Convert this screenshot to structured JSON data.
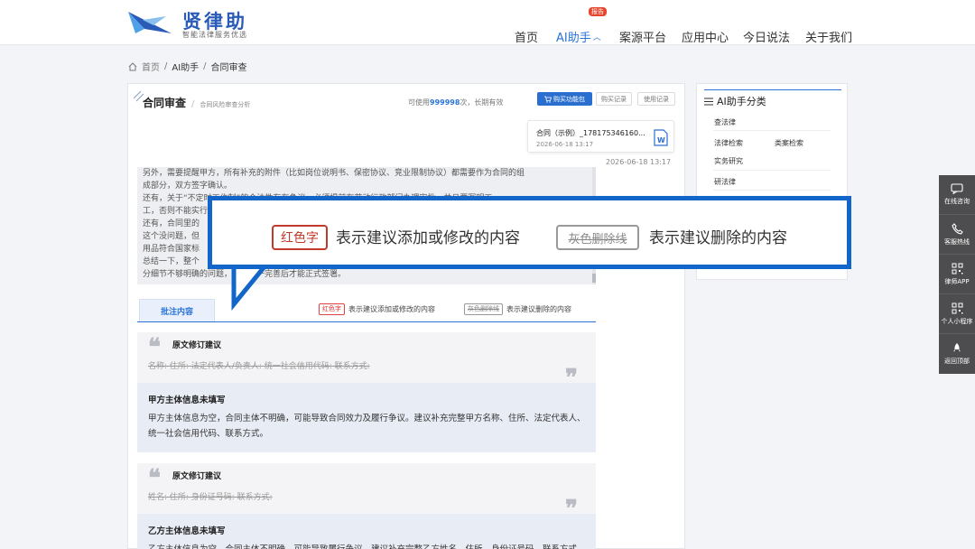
{
  "brand": {
    "name": "贤律助",
    "slogan": "智能法律服务优选"
  },
  "nav": {
    "items": [
      {
        "label": "首页"
      },
      {
        "label": "AI助手"
      },
      {
        "label": "案源平台"
      },
      {
        "label": "应用中心"
      },
      {
        "label": "今日说法"
      },
      {
        "label": "关于我们"
      }
    ],
    "hot_badge": "报告",
    "active_index": 1
  },
  "breadcrumb": {
    "home": "首页",
    "sep1": "/",
    "level1": "AI助手",
    "sep2": "/",
    "current": "合同审查"
  },
  "panel": {
    "title": "合同审查",
    "title_sep": "/",
    "subtitle": "合同风险审查分析",
    "avail_prefix": "可使用",
    "avail_count": "999998",
    "avail_suffix": "次，长期有效",
    "buy_label": "购买功能包",
    "purchase_record": "购买记录",
    "usage_record": "使用记录",
    "file": {
      "name": "合同（示例）_178175346160...",
      "date": "2026-06-18 13:17"
    },
    "timestamp": "2026-06-18 13:17",
    "text_lines": [
      "另外，需要提醒甲方，所有补充的附件（比如岗位说明书、保密协议、竞业限制协议）都需要作为合同的组",
      "成部分，双方签字确认。",
      "还有，关于“不定时工作制”的合法性存在争议，必须提前在劳动行政部门办理审批，并且要写明工",
      "工，否则不能实行。",
      "还有，合同里的",
      "这个没问题，但",
      "用品符合国家标",
      "总结一下，整个",
      "分细节不够明确的问题，需要逐一完善后才能正式签署。"
    ]
  },
  "annotation_tab": {
    "label": "批注内容",
    "legend_red_tag": "红色字",
    "legend_red_text": "表示建议添加或修改的内容",
    "legend_gray_tag": "灰色删除线",
    "legend_gray_text": "表示建议删除的内容"
  },
  "cards": [
    {
      "type": "revision",
      "title": "原文修订建议",
      "deleted": "名称: 住所: 法定代表人/负责人: 统一社会信用代码: 联系方式:"
    },
    {
      "type": "info",
      "title": "甲方主体信息未填写",
      "body": "甲方主体信息为空，合同主体不明确，可能导致合同效力及履行争议。建议补充完整甲方名称、住所、法定代表人、统一社会信用代码、联系方式。"
    },
    {
      "type": "revision",
      "title": "原文修订建议",
      "deleted": "姓名: 住所: 身份证号码: 联系方式:"
    },
    {
      "type": "info",
      "title": "乙方主体信息未填写",
      "body": "乙方主体信息为空，合同主体不明确，可能导致履行争议。建议补充完整乙方姓名、住所、身份证号码、联系方式。"
    }
  ],
  "side": {
    "title": "AI助手分类",
    "items": [
      "查法律",
      "法律检索",
      "类案检索",
      "实务研究",
      "研法律"
    ]
  },
  "float_bar": {
    "items": [
      {
        "label": "在线咨询",
        "icon": "chat-icon"
      },
      {
        "label": "客服热线",
        "icon": "phone-icon"
      },
      {
        "label": "律师APP",
        "icon": "qr-icon"
      },
      {
        "label": "个人小程序",
        "icon": "qr-icon"
      },
      {
        "label": "返回顶部",
        "icon": "rocket-icon"
      }
    ]
  },
  "overlay": {
    "red_tag": "红色字",
    "red_text": "表示建议添加或修改的内容",
    "gray_tag": "灰色删除线",
    "gray_text": "表示建议删除的内容"
  },
  "colors": {
    "accent": "#2a74d8",
    "overlay_border": "#1266c9",
    "red": "#c0392b",
    "float_bg": "#4d4d4f"
  }
}
